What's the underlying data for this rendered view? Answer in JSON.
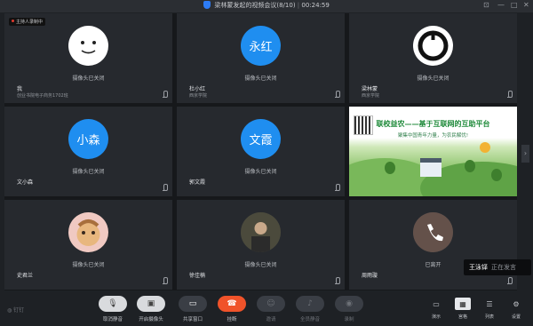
{
  "window": {
    "title": "梁林蒙发起的视频会议(8/10)",
    "timer": "00:24:59"
  },
  "recording_badge": "主持人录制中",
  "camera_off_label": "摄像头已关闭",
  "participants": [
    {
      "name": "我",
      "subtitle": "创业书院电子商务1702班",
      "avatar_type": "face"
    },
    {
      "name": "杜小红",
      "subtitle": "西京学院",
      "avatar_text": "永红"
    },
    {
      "name": "梁林蒙",
      "subtitle": "西京学院",
      "avatar_type": "ring"
    },
    {
      "name": "文小森",
      "subtitle": "",
      "avatar_text": "小森"
    },
    {
      "name": "郭文霞",
      "subtitle": "",
      "avatar_text": "文霞"
    },
    {
      "name": "史君兰",
      "subtitle": "",
      "avatar_type": "photo"
    },
    {
      "name": "徐佳楠",
      "subtitle": "",
      "avatar_type": "photo"
    },
    {
      "name": "周雨璇",
      "subtitle": "",
      "avatar_type": "hangup",
      "status": "已离开"
    }
  ],
  "shared_screen": {
    "headline": "联校益农——基于互联网的互助平台",
    "tagline": "聚集中国青年力量，为农民解忧!"
  },
  "speaking_toast": {
    "name": "王泳铎",
    "state": "正在发言"
  },
  "toolbar": {
    "brand": "钉钉",
    "buttons": [
      {
        "label": "取消静音",
        "icon": "mic-muted-icon",
        "style": "light"
      },
      {
        "label": "开启摄像头",
        "icon": "camera-off-icon",
        "style": "light"
      },
      {
        "label": "共享窗口",
        "icon": "screen-share-icon",
        "style": "dark"
      },
      {
        "label": "挂断",
        "icon": "hangup-icon",
        "style": "red"
      },
      {
        "label": "邀请",
        "icon": "invite-icon",
        "style": "dark",
        "disabled": true
      },
      {
        "label": "全员静音",
        "icon": "mute-all-icon",
        "style": "dark",
        "disabled": true
      },
      {
        "label": "录制",
        "icon": "record-icon",
        "style": "dark",
        "disabled": true
      }
    ],
    "views": [
      {
        "label": "演示",
        "icon": "presentation-icon"
      },
      {
        "label": "宫格",
        "icon": "grid-icon",
        "active": true
      },
      {
        "label": "列表",
        "icon": "list-icon"
      },
      {
        "label": "设置",
        "icon": "settings-icon"
      }
    ]
  },
  "colors": {
    "accent_blue": "#1f8ef0",
    "hangup_red": "#f0532a",
    "background": "#1e2125"
  }
}
